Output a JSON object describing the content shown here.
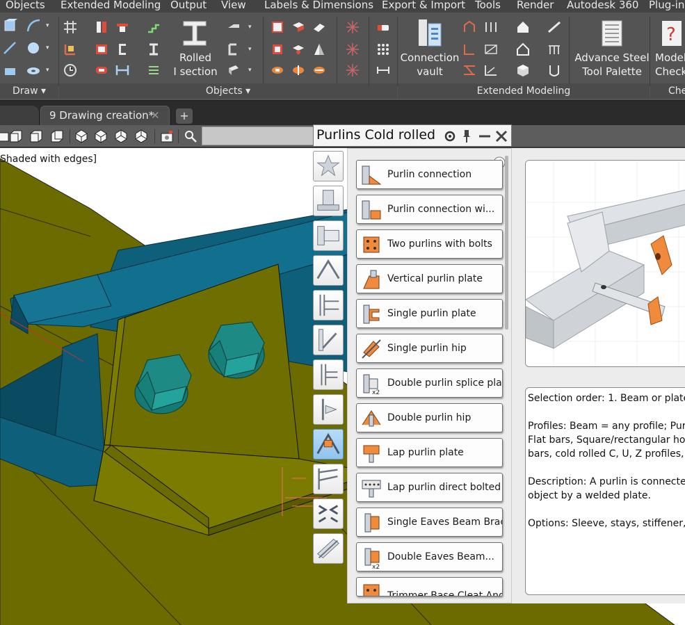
{
  "menubar": {
    "items": [
      "Objects",
      "Extended Modeling",
      "Output",
      "View",
      "Labels & Dimensions",
      "Export & Import",
      "Tools",
      "Render",
      "Autodesk 360",
      "Plug-ins"
    ]
  },
  "ribbon": {
    "rolled_section_label_1": "Rolled",
    "rolled_section_label_2": "I section",
    "connection_vault_label_1": "Connection",
    "connection_vault_label_2": "vault",
    "tool_palette_label_1": "Advance Steel",
    "tool_palette_label_2": "Tool Palette",
    "model_check_label_1": "Model",
    "model_check_label_2": "Check",
    "panels": {
      "draw": "Draw",
      "objects": "Objects",
      "extended_modeling": "Extended Modeling",
      "checking": "Che"
    }
  },
  "tabs": {
    "active": "9 Drawing creation*",
    "add_label": "+"
  },
  "viewport": {
    "view_style": "Shaded with edges]",
    "colors": {
      "ground": "#6b6b00",
      "beam": "#0e5f7a",
      "plate": "#6e6f00",
      "bolt": "#1d8a84"
    }
  },
  "palette": {
    "title": "Purlins  Cold rolled",
    "items": [
      "Purlin connection",
      "Purlin connection wi...",
      "Two purlins with bolts",
      "Vertical purlin plate",
      "Single purlin plate",
      "Single purlin hip",
      "Double purlin splice pla...",
      "Double purlin hip",
      "Lap purlin plate",
      "Lap purlin direct bolted",
      "Single Eaves Beam Brack...",
      "Double Eaves Beam...",
      "Trimmer Base Cleat Angle"
    ],
    "description": {
      "selection": "Selection order: 1. Beam or plate,",
      "profiles_1": "Profiles: Beam = any profile; Purli",
      "profiles_2": "Flat bars, Square/rectangular holl",
      "profiles_3": "bars, cold rolled C, U, Z profiles,",
      "desc_1": "Description: A purlin is connected",
      "desc_2": "object by a welded plate.",
      "options": "Options: Sleeve, stays, stiffener, s"
    },
    "accent_color": "#f08a3c"
  }
}
